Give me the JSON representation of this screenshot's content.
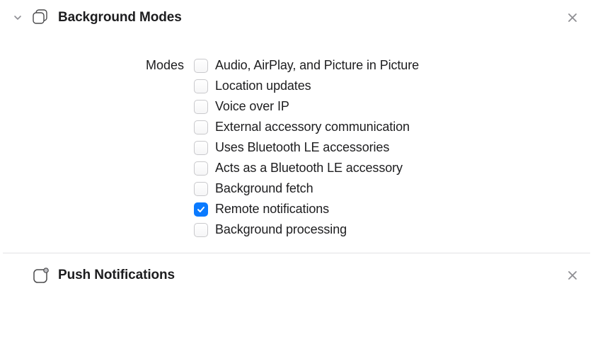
{
  "sections": {
    "backgroundModes": {
      "title": "Background Modes",
      "modesLabel": "Modes",
      "options": [
        {
          "label": "Audio, AirPlay, and Picture in Picture",
          "checked": false
        },
        {
          "label": "Location updates",
          "checked": false
        },
        {
          "label": "Voice over IP",
          "checked": false
        },
        {
          "label": "External accessory communication",
          "checked": false
        },
        {
          "label": "Uses Bluetooth LE accessories",
          "checked": false
        },
        {
          "label": "Acts as a Bluetooth LE accessory",
          "checked": false
        },
        {
          "label": "Background fetch",
          "checked": false
        },
        {
          "label": "Remote notifications",
          "checked": true
        },
        {
          "label": "Background processing",
          "checked": false
        }
      ]
    },
    "pushNotifications": {
      "title": "Push Notifications"
    }
  }
}
